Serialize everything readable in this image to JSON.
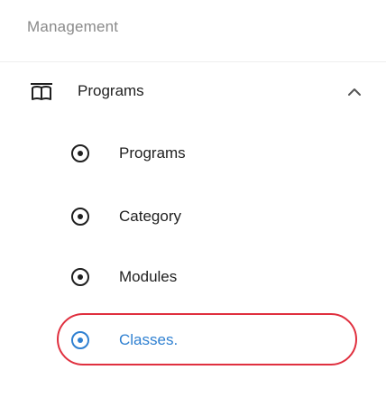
{
  "sidebar": {
    "section_title": "Management",
    "group": {
      "label": "Programs",
      "icon": "book-open-icon",
      "expanded": true,
      "chevron_icon": "chevron-up-icon"
    },
    "items": [
      {
        "label": "Programs",
        "icon": "radio-dot-icon",
        "active": false
      },
      {
        "label": "Category",
        "icon": "radio-dot-icon",
        "active": false
      },
      {
        "label": "Modules",
        "icon": "radio-dot-icon",
        "active": false
      },
      {
        "label": "Classes.",
        "icon": "radio-dot-icon",
        "active": true
      }
    ]
  },
  "colors": {
    "text": "#1f1f1f",
    "muted": "#8a8a8a",
    "active": "#2f80d1",
    "highlight": "#e0303f"
  }
}
